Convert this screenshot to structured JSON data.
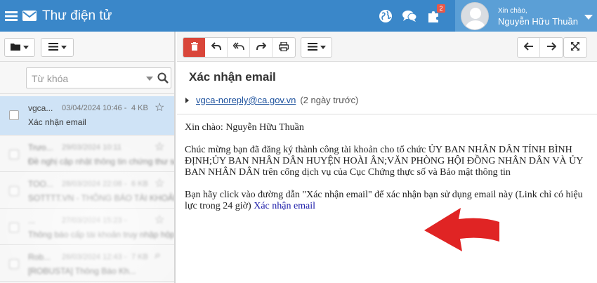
{
  "app": {
    "title": "Thư điện tử",
    "menu_icon": "hamburger-icon",
    "mail_icon": "envelope-icon",
    "accent_color": "#3a87c9"
  },
  "header": {
    "icons": [
      "globe-icon",
      "chat-icon",
      "puzzle-icon"
    ],
    "notification_count": "2",
    "user": {
      "greeting": "Xin chào,",
      "name": "Nguyễn Hữu Thuần"
    }
  },
  "search": {
    "placeholder": "Từ khóa"
  },
  "mail_list": [
    {
      "from": "vgca...",
      "date": "03/04/2024 10:46 -",
      "size": "4 KB",
      "subject": "Xác nhận email",
      "selected": true
    },
    {
      "from": "Trưo...",
      "date": "29/03/2024 10:11",
      "size": "",
      "subject": "Đề nghị cập nhật thông tin chứng thư số",
      "selected": false
    },
    {
      "from": "TOO...",
      "date": "28/03/2024 22:08 -",
      "size": "6 KB",
      "subject": "SOTTTT.VN - THÔNG BÁO TÀI KHOẢN",
      "selected": false
    },
    {
      "from": "...",
      "date": "27/03/2024 15:23 -",
      "size": "",
      "subject": "Thông báo cấp tài khoản truy nhập hộp thư...",
      "selected": false
    },
    {
      "from": "Rob...",
      "date": "26/03/2024 12:43 -",
      "size": "7 KB",
      "subject": "[ROBUSTA] Thông Báo Kh...",
      "selected": false
    }
  ],
  "message": {
    "subject": "Xác nhận email",
    "sender": "vgca-noreply@ca.gov.vn",
    "time": "(2 ngày trước)",
    "greeting": "Xin chào: Nguyễn Hữu Thuần",
    "paragraph1": "Chúc mừng bạn đã đăng ký thành công tài khoản cho tổ chức ỦY BAN NHÂN DÂN TỈNH BÌNH ĐỊNH;ỦY BAN NHÂN DÂN HUYỆN HOÀI ÂN;VĂN PHÒNG HỘI ĐỒNG NHÂN DÂN VÀ ỦY BAN NHÂN DÂN trên cổng dịch vụ của Cục Chứng thực số và Bảo mật thông tin",
    "paragraph2": "Bạn hãy click vào đường dẫn \"Xác nhận email\" để xác nhận bạn sử dụng email này (Link chỉ có hiệu lực trong 24 giờ)",
    "confirm_link": "Xác nhận email"
  },
  "colors": {
    "delete_button": "#d9463a",
    "arrow": "#e02424",
    "selected_row": "#cfe3f6"
  }
}
